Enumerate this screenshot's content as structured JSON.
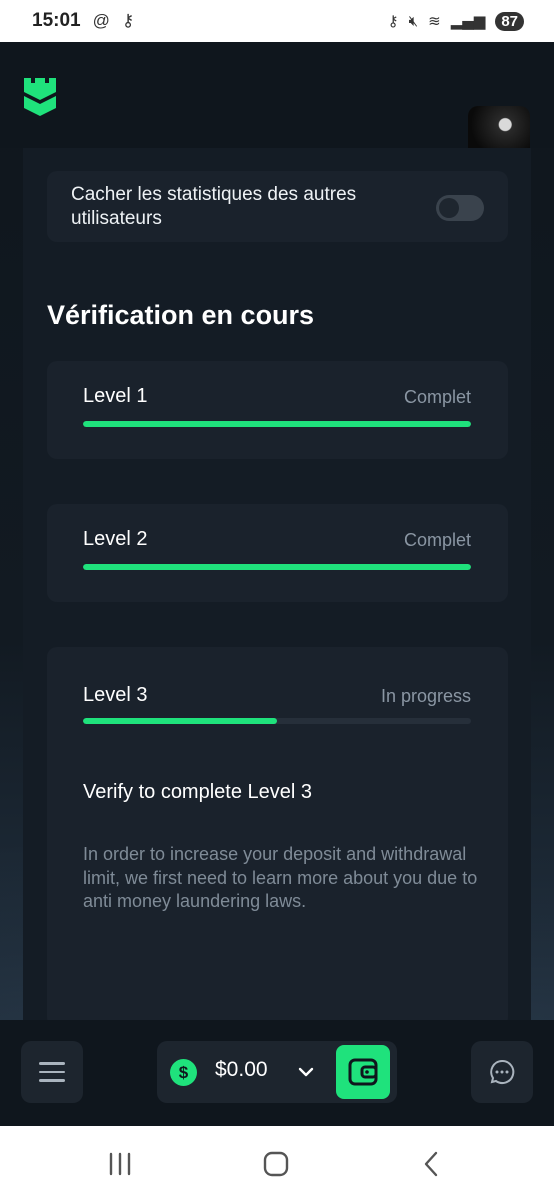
{
  "status_bar": {
    "time": "15:01",
    "battery": "87"
  },
  "settings": {
    "hide_stats_label": "Cacher les statistiques des autres utilisateurs",
    "hide_stats_on": false
  },
  "verification": {
    "title": "Vérification en cours",
    "levels": [
      {
        "name": "Level 1",
        "status": "Complet",
        "progress": 1.0
      },
      {
        "name": "Level 2",
        "status": "Complet",
        "progress": 1.0
      },
      {
        "name": "Level 3",
        "status": "In progress",
        "progress": 0.5
      }
    ],
    "cta_title": "Verify to complete Level 3",
    "cta_description": "In order to increase your deposit and withdrawal limit, we first need to learn more about you due to anti money laundering laws."
  },
  "bottom_bar": {
    "currency_symbol": "$",
    "balance": "$0.00"
  },
  "colors": {
    "accent": "#1fe27c",
    "background": "#0e141b",
    "card": "#1a222c"
  },
  "icons": {
    "logo": "castle-logo-icon",
    "menu": "hamburger-menu-icon",
    "dropdown": "chevron-down-icon",
    "wallet": "wallet-icon",
    "chat": "chat-bubble-icon"
  }
}
